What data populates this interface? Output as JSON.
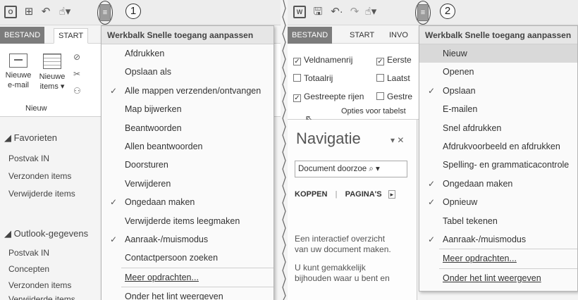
{
  "callouts": [
    "1",
    "2"
  ],
  "left": {
    "tabs": {
      "file": "BESTAND",
      "start": "START"
    },
    "menu": {
      "title": "Werkbalk Snelle toegang aanpassen",
      "items": [
        {
          "label": "Afdrukken",
          "checked": false
        },
        {
          "label": "Opslaan als",
          "checked": false
        },
        {
          "label": "Alle mappen verzenden/ontvangen",
          "checked": true
        },
        {
          "label": "Map bijwerken",
          "checked": false
        },
        {
          "label": "Beantwoorden",
          "checked": false
        },
        {
          "label": "Allen beantwoorden",
          "checked": false
        },
        {
          "label": "Doorsturen",
          "checked": false
        },
        {
          "label": "Verwijderen",
          "checked": false
        },
        {
          "label": "Ongedaan maken",
          "checked": true
        },
        {
          "label": "Verwijderde items leegmaken",
          "checked": false
        },
        {
          "label": "Aanraak-/muismodus",
          "checked": true
        },
        {
          "label": "Contactpersoon zoeken",
          "checked": false
        }
      ],
      "more": "Meer opdrachten...",
      "below": "Onder het lint weergeven"
    },
    "ribbon": {
      "new_email_1": "Nieuwe",
      "new_email_2": "e-mail",
      "new_items_1": "Nieuwe",
      "new_items_2": "items",
      "group": "Nieuw"
    },
    "nav": {
      "fav": "Favorieten",
      "fav_items": [
        "Postvak IN",
        "Verzonden items",
        "Verwijderde items"
      ],
      "data": "Outlook-gegevens",
      "data_items": [
        "Postvak IN",
        "Concepten",
        "Verzonden items",
        "Verwijderde items"
      ]
    }
  },
  "right": {
    "tabs": {
      "file": "BESTAND",
      "start": "START",
      "insert": "INVO"
    },
    "options": {
      "row1a": "Veldnamenrij",
      "row1b": "Eerste",
      "row2a": "Totaalrij",
      "row2b": "Laatst",
      "row3a": "Gestreepte rijen",
      "row3b": "Gestre",
      "group": "Opties voor tabelst"
    },
    "menu": {
      "title": "Werkbalk Snelle toegang aanpassen",
      "items": [
        {
          "label": "Nieuw",
          "checked": false,
          "highlight": true
        },
        {
          "label": "Openen",
          "checked": false
        },
        {
          "label": "Opslaan",
          "checked": true
        },
        {
          "label": "E-mailen",
          "checked": false
        },
        {
          "label": "Snel afdrukken",
          "checked": false
        },
        {
          "label": "Afdrukvoorbeeld en afdrukken",
          "checked": false
        },
        {
          "label": "Spelling- en grammaticacontrole",
          "checked": false
        },
        {
          "label": "Ongedaan maken",
          "checked": true
        },
        {
          "label": "Opnieuw",
          "checked": true
        },
        {
          "label": "Tabel tekenen",
          "checked": false
        },
        {
          "label": "Aanraak-/muismodus",
          "checked": true
        }
      ],
      "more": "Meer opdrachten...",
      "below": "Onder het lint weergeven"
    },
    "navpane": {
      "title": "Navigatie",
      "search_placeholder": "Document doorzoe",
      "tab_headings": "KOPPEN",
      "tab_pages": "PAGINA'S",
      "text1a": "Een interactief overzicht",
      "text1b": "van uw document maken.",
      "text2a": "U kunt gemakkelijk",
      "text2b": "bijhouden waar u bent en"
    }
  }
}
